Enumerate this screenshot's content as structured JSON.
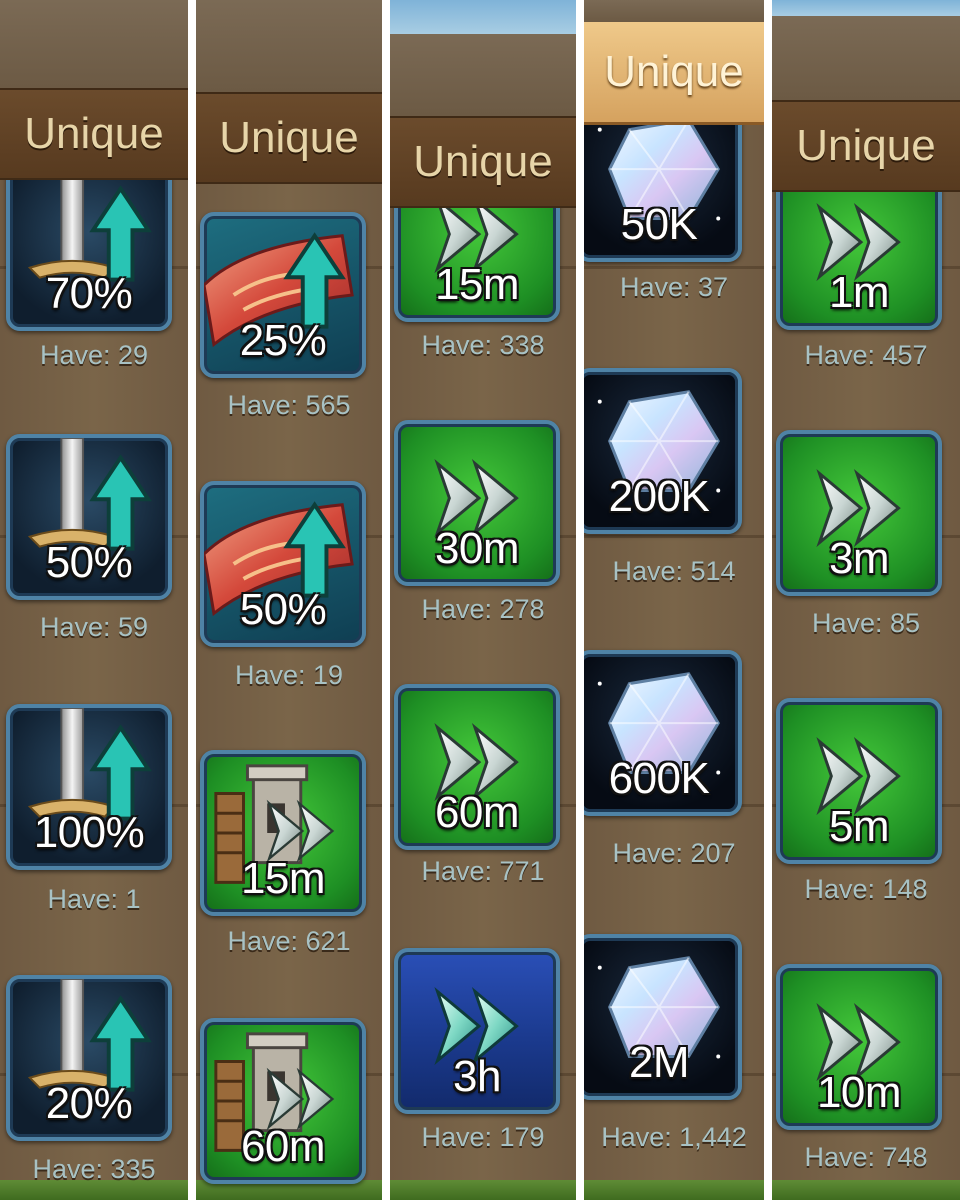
{
  "columns": [
    {
      "header": "Unique",
      "items": [
        {
          "icon": "sword-upgrade-icon",
          "amount": "70%",
          "have": "Have: 29"
        },
        {
          "icon": "sword-upgrade-icon",
          "amount": "50%",
          "have": "Have: 59"
        },
        {
          "icon": "sword-upgrade-icon",
          "amount": "100%",
          "have": "Have: 1"
        },
        {
          "icon": "sword-upgrade-icon",
          "amount": "20%",
          "have": "Have: 335"
        }
      ]
    },
    {
      "header": "Unique",
      "items": [
        {
          "icon": "banner-upgrade-icon",
          "amount": "25%",
          "have": "Have: 565"
        },
        {
          "icon": "banner-upgrade-icon",
          "amount": "50%",
          "have": "Have: 19"
        },
        {
          "icon": "castle-speedup-icon",
          "amount": "15m",
          "have": "Have: 621"
        },
        {
          "icon": "castle-speedup-icon",
          "amount": "60m",
          "have": ""
        }
      ]
    },
    {
      "header": "Unique",
      "items": [
        {
          "icon": "speedup-arrows-icon",
          "amount": "15m",
          "have": "Have: 338"
        },
        {
          "icon": "speedup-arrows-icon",
          "amount": "30m",
          "have": "Have: 278"
        },
        {
          "icon": "speedup-arrows-icon",
          "amount": "60m",
          "have": "Have: 771"
        },
        {
          "icon": "blue-speedup-arrows-icon",
          "amount": "3h",
          "have": "Have: 179"
        }
      ]
    },
    {
      "header": "Unique",
      "items": [
        {
          "icon": "gem-crystal-icon",
          "amount": "50K",
          "have": "Have: 37"
        },
        {
          "icon": "gem-crystal-icon",
          "amount": "200K",
          "have": "Have: 514"
        },
        {
          "icon": "gem-crystal-icon",
          "amount": "600K",
          "have": "Have: 207"
        },
        {
          "icon": "gem-crystal-icon",
          "amount": "2M",
          "have": "Have: 1,442"
        }
      ]
    },
    {
      "header": "Unique",
      "items": [
        {
          "icon": "speedup-arrows-icon",
          "amount": "1m",
          "have": "Have: 457"
        },
        {
          "icon": "speedup-arrows-icon",
          "amount": "3m",
          "have": "Have: 85"
        },
        {
          "icon": "speedup-arrows-icon",
          "amount": "5m",
          "have": "Have: 148"
        },
        {
          "icon": "speedup-arrows-icon",
          "amount": "10m",
          "have": "Have: 748"
        }
      ]
    }
  ],
  "colors": {
    "wood": "#7a6549",
    "header_brown": "#573a1f",
    "header_gold": "#d5a25f",
    "header_text": "#e7d5a9",
    "have_text": "#a8c2c4",
    "tile_border": "#4f83a6",
    "speedup_green": "#1e8f24"
  }
}
